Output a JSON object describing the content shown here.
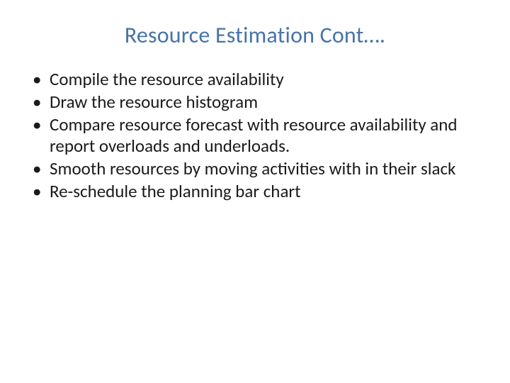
{
  "slide": {
    "title": "Resource Estimation Cont….",
    "bullets": [
      "Compile the resource availability",
      "Draw the resource histogram",
      "Compare resource forecast with resource availability and report overloads and underloads.",
      "Smooth resources by moving activities with in their slack",
      "Re-schedule the planning bar chart"
    ]
  }
}
